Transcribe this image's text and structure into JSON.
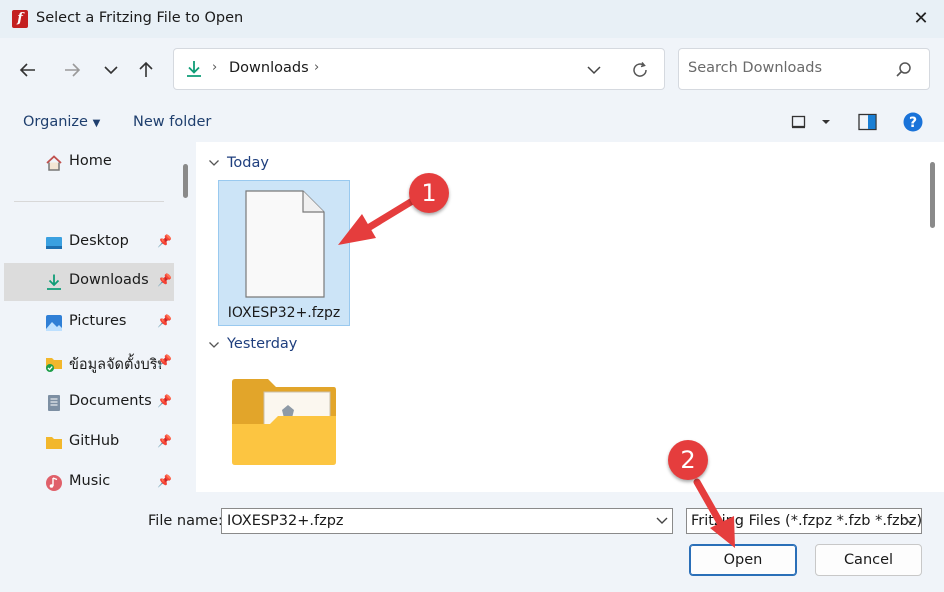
{
  "window": {
    "title": "Select a Fritzing File to Open",
    "app_icon_glyph": "f",
    "close_glyph": "✕"
  },
  "nav": {
    "address_segment": "Downloads",
    "search_placeholder": "Search Downloads"
  },
  "toolbar": {
    "organize_label": "Organize",
    "new_folder_label": "New folder"
  },
  "sidebar": {
    "items": [
      {
        "label": "Home",
        "icon": "home-icon"
      },
      {
        "label": "Desktop",
        "icon": "desktop-icon",
        "pinned": true
      },
      {
        "label": "Downloads",
        "icon": "download-icon",
        "pinned": true,
        "selected": true
      },
      {
        "label": "Pictures",
        "icon": "pictures-icon",
        "pinned": true
      },
      {
        "label": "ข้อมูลจัดตั้งบริษัท",
        "icon": "folder-synced-icon",
        "pinned": true
      },
      {
        "label": "Documents",
        "icon": "documents-icon",
        "pinned": true
      },
      {
        "label": "GitHub",
        "icon": "folder-icon",
        "pinned": true
      },
      {
        "label": "Music",
        "icon": "music-icon",
        "pinned": true
      }
    ]
  },
  "content": {
    "groups": [
      {
        "header": "Today",
        "files": [
          {
            "name": "IOXESP32+.fzpz",
            "type": "file",
            "selected": true
          }
        ]
      },
      {
        "header": "Yesterday",
        "files": [
          {
            "name": "",
            "type": "folder"
          }
        ]
      }
    ]
  },
  "footer": {
    "filename_label": "File name:",
    "filename_value": "IOXESP32+.fzpz",
    "filetype_value": "Fritzing Files (*.fzpz *.fzb *.fzbz)",
    "open_label": "Open",
    "cancel_label": "Cancel"
  },
  "annotations": {
    "badge1": "1",
    "badge2": "2",
    "color": "#e53d3d"
  }
}
